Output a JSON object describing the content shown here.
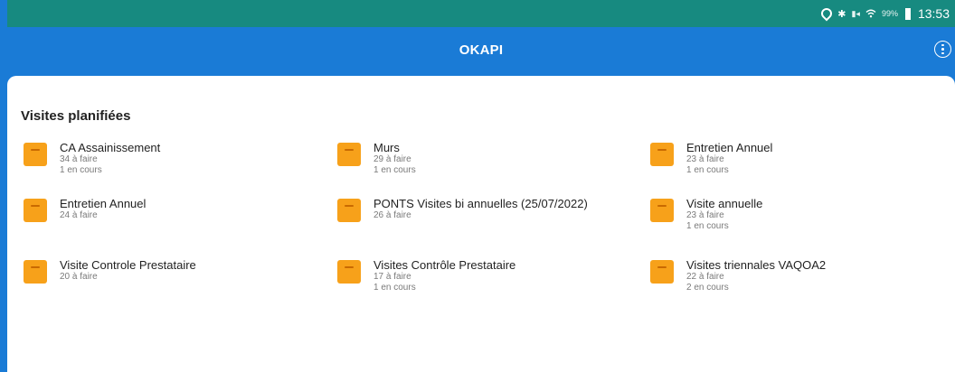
{
  "status_bar": {
    "battery": "99%",
    "time": "13:53"
  },
  "app_bar": {
    "title": "OKAPI"
  },
  "section": {
    "title": "Visites planifiées"
  },
  "visits": [
    {
      "name": "CA Assainissement",
      "todo": "34 à faire",
      "in_progress": "1 en cours"
    },
    {
      "name": "Murs",
      "todo": "29 à faire",
      "in_progress": "1 en cours"
    },
    {
      "name": "Entretien Annuel",
      "todo": "23 à faire",
      "in_progress": "1 en cours"
    },
    {
      "name": "Entretien Annuel",
      "todo": "24 à faire",
      "in_progress": ""
    },
    {
      "name": "PONTS Visites bi annuelles (25/07/2022)",
      "todo": "26 à faire",
      "in_progress": ""
    },
    {
      "name": "Visite annuelle",
      "todo": "23 à faire",
      "in_progress": "1 en cours"
    },
    {
      "name": "Visite Controle Prestataire",
      "todo": "20 à faire",
      "in_progress": ""
    },
    {
      "name": "Visites Contrôle Prestataire",
      "todo": "17 à faire",
      "in_progress": "1 en cours"
    },
    {
      "name": "Visites triennales VAQOA2",
      "todo": "22 à faire",
      "in_progress": "2 en cours"
    }
  ],
  "colors": {
    "primary": "#1a7bd6",
    "status_bar": "#178a80",
    "folder": "#f7a11a"
  },
  "icons": {
    "location": "location-icon",
    "bluetooth": "bluetooth-icon",
    "wifi": "wifi-icon",
    "battery": "battery-icon",
    "more": "more-vertical-icon",
    "folder": "folder-icon"
  }
}
